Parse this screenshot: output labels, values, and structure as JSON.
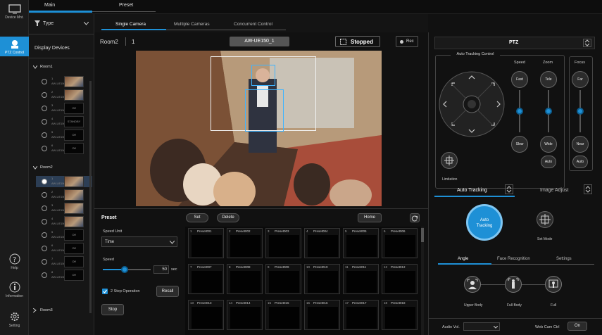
{
  "rail": {
    "items": [
      {
        "label": "Device Mnt."
      },
      {
        "label": "PTZ Control"
      },
      {
        "label": "Help"
      },
      {
        "label": "Information"
      },
      {
        "label": "Setting"
      }
    ]
  },
  "topbar": {
    "tabs": [
      {
        "label": "Main"
      },
      {
        "label": "Preset"
      }
    ]
  },
  "sidebar": {
    "type_label": "Type",
    "title": "Display Devices",
    "group1": "Room1",
    "group2": "Room2",
    "group3": "Room3",
    "room1": [
      {
        "num": "1",
        "name": "AW-UE150",
        "thumb": "",
        "live": true
      },
      {
        "num": "2",
        "name": "AW-UE150",
        "thumb": "",
        "live": true
      },
      {
        "num": "3",
        "name": "AW-UE150",
        "thumb": "Off",
        "live": false
      },
      {
        "num": "4",
        "name": "AW-UE150",
        "thumb": "STANDBY",
        "live": false
      },
      {
        "num": "5",
        "name": "AW-UE150",
        "thumb": "Off",
        "live": false
      },
      {
        "num": "6",
        "name": "AW-UE150",
        "thumb": "Off",
        "live": false
      }
    ],
    "room2": [
      {
        "num": "1",
        "name": "AW-UE150_1",
        "thumb": "",
        "live": true
      },
      {
        "num": "2",
        "name": "AW-UE150_2",
        "thumb": "",
        "live": true
      },
      {
        "num": "3",
        "name": "AW-UE150_3",
        "thumb": "",
        "live": true
      },
      {
        "num": "4",
        "name": "AW-UE150_4",
        "thumb": "",
        "live": true
      },
      {
        "num": "5",
        "name": "AW-UE150_5",
        "thumb": "Off",
        "live": false
      },
      {
        "num": "6",
        "name": "AW-UE150_6",
        "thumb": "Off",
        "live": false
      },
      {
        "num": "7",
        "name": "AW-UE150_7",
        "thumb": "Off",
        "live": false
      },
      {
        "num": "8",
        "name": "AW-UE150_8",
        "thumb": "Off",
        "live": false
      }
    ]
  },
  "subtabs": [
    {
      "label": "Single Camera"
    },
    {
      "label": "Multiple Cameras"
    },
    {
      "label": "Concurrent Control"
    }
  ],
  "camera": {
    "room": "Room2",
    "index": "1",
    "name": "AW-UE150_1",
    "status": "Stopped",
    "rec": "Rec"
  },
  "preset": {
    "title": "Preset",
    "set": "Set",
    "delete": "Delete",
    "home": "Home",
    "speed_unit_label": "Speed Unit",
    "speed_unit_value": "Time",
    "speed_label": "Speed",
    "speed_value": "50",
    "speed_unit": "sec",
    "two_step": "2 Step Operation",
    "recall": "Recall",
    "stop": "Stop",
    "cells": [
      {
        "n": "1",
        "l": "Preset001"
      },
      {
        "n": "2",
        "l": "Preset002"
      },
      {
        "n": "3",
        "l": "Preset003"
      },
      {
        "n": "4",
        "l": "Preset004"
      },
      {
        "n": "5",
        "l": "Preset005"
      },
      {
        "n": "6",
        "l": "Preset006"
      },
      {
        "n": "7",
        "l": "Preset007"
      },
      {
        "n": "8",
        "l": "Preset008"
      },
      {
        "n": "9",
        "l": "Preset009"
      },
      {
        "n": "10",
        "l": "Preset010"
      },
      {
        "n": "11",
        "l": "Preset011"
      },
      {
        "n": "12",
        "l": "Preset012"
      },
      {
        "n": "13",
        "l": "Preset013"
      },
      {
        "n": "14",
        "l": "Preset014"
      },
      {
        "n": "15",
        "l": "Preset015"
      },
      {
        "n": "16",
        "l": "Preset016"
      },
      {
        "n": "17",
        "l": "Preset017"
      },
      {
        "n": "18",
        "l": "Preset018"
      }
    ]
  },
  "ptz": {
    "title": "PTZ",
    "auto_tracking_control": "Auto Tracking Control",
    "speed": "Speed",
    "zoom": "Zoom",
    "focus": "Focus",
    "fast": "Fast",
    "slow": "Slow",
    "tele": "Tele",
    "wide": "Wide",
    "far": "Far",
    "near": "Near",
    "auto": "Auto",
    "limitation": "Limitation"
  },
  "tracking": {
    "tab_auto": "Auto Tracking",
    "tab_image": "Image Adjust",
    "button": "Auto Tracking",
    "button_line1": "Auto",
    "button_line2": "Tracking",
    "set_mode": "Set Mode",
    "subtabs": [
      {
        "label": "Angle"
      },
      {
        "label": "Face Recognition"
      },
      {
        "label": "Settings"
      }
    ],
    "angles": [
      {
        "label": "Upper Body"
      },
      {
        "label": "Full Body"
      },
      {
        "label": "Full"
      }
    ]
  },
  "footer": {
    "audio": "Audio Vol.",
    "webcam": "Web Cam Ctrl",
    "on": "On"
  },
  "colors": {
    "accent": "#1e90d6",
    "background": "#111111"
  }
}
